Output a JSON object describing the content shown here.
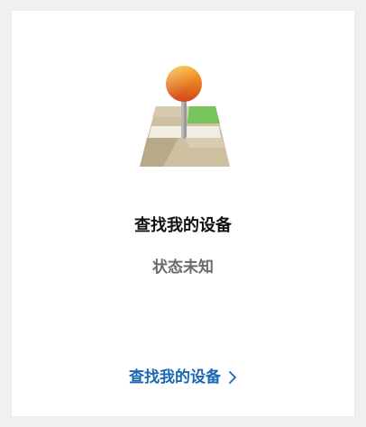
{
  "card": {
    "title": "查找我的设备",
    "status": "状态未知",
    "link_label": "查找我的设备"
  },
  "icons": {
    "illustration": "map-pin-icon",
    "link_chevron": "chevron-right-icon"
  },
  "colors": {
    "link": "#1a67b3",
    "title": "#111111",
    "status": "#6b6b6b",
    "pin_top": "#f39a1c",
    "pin_bottom": "#d84d12"
  }
}
